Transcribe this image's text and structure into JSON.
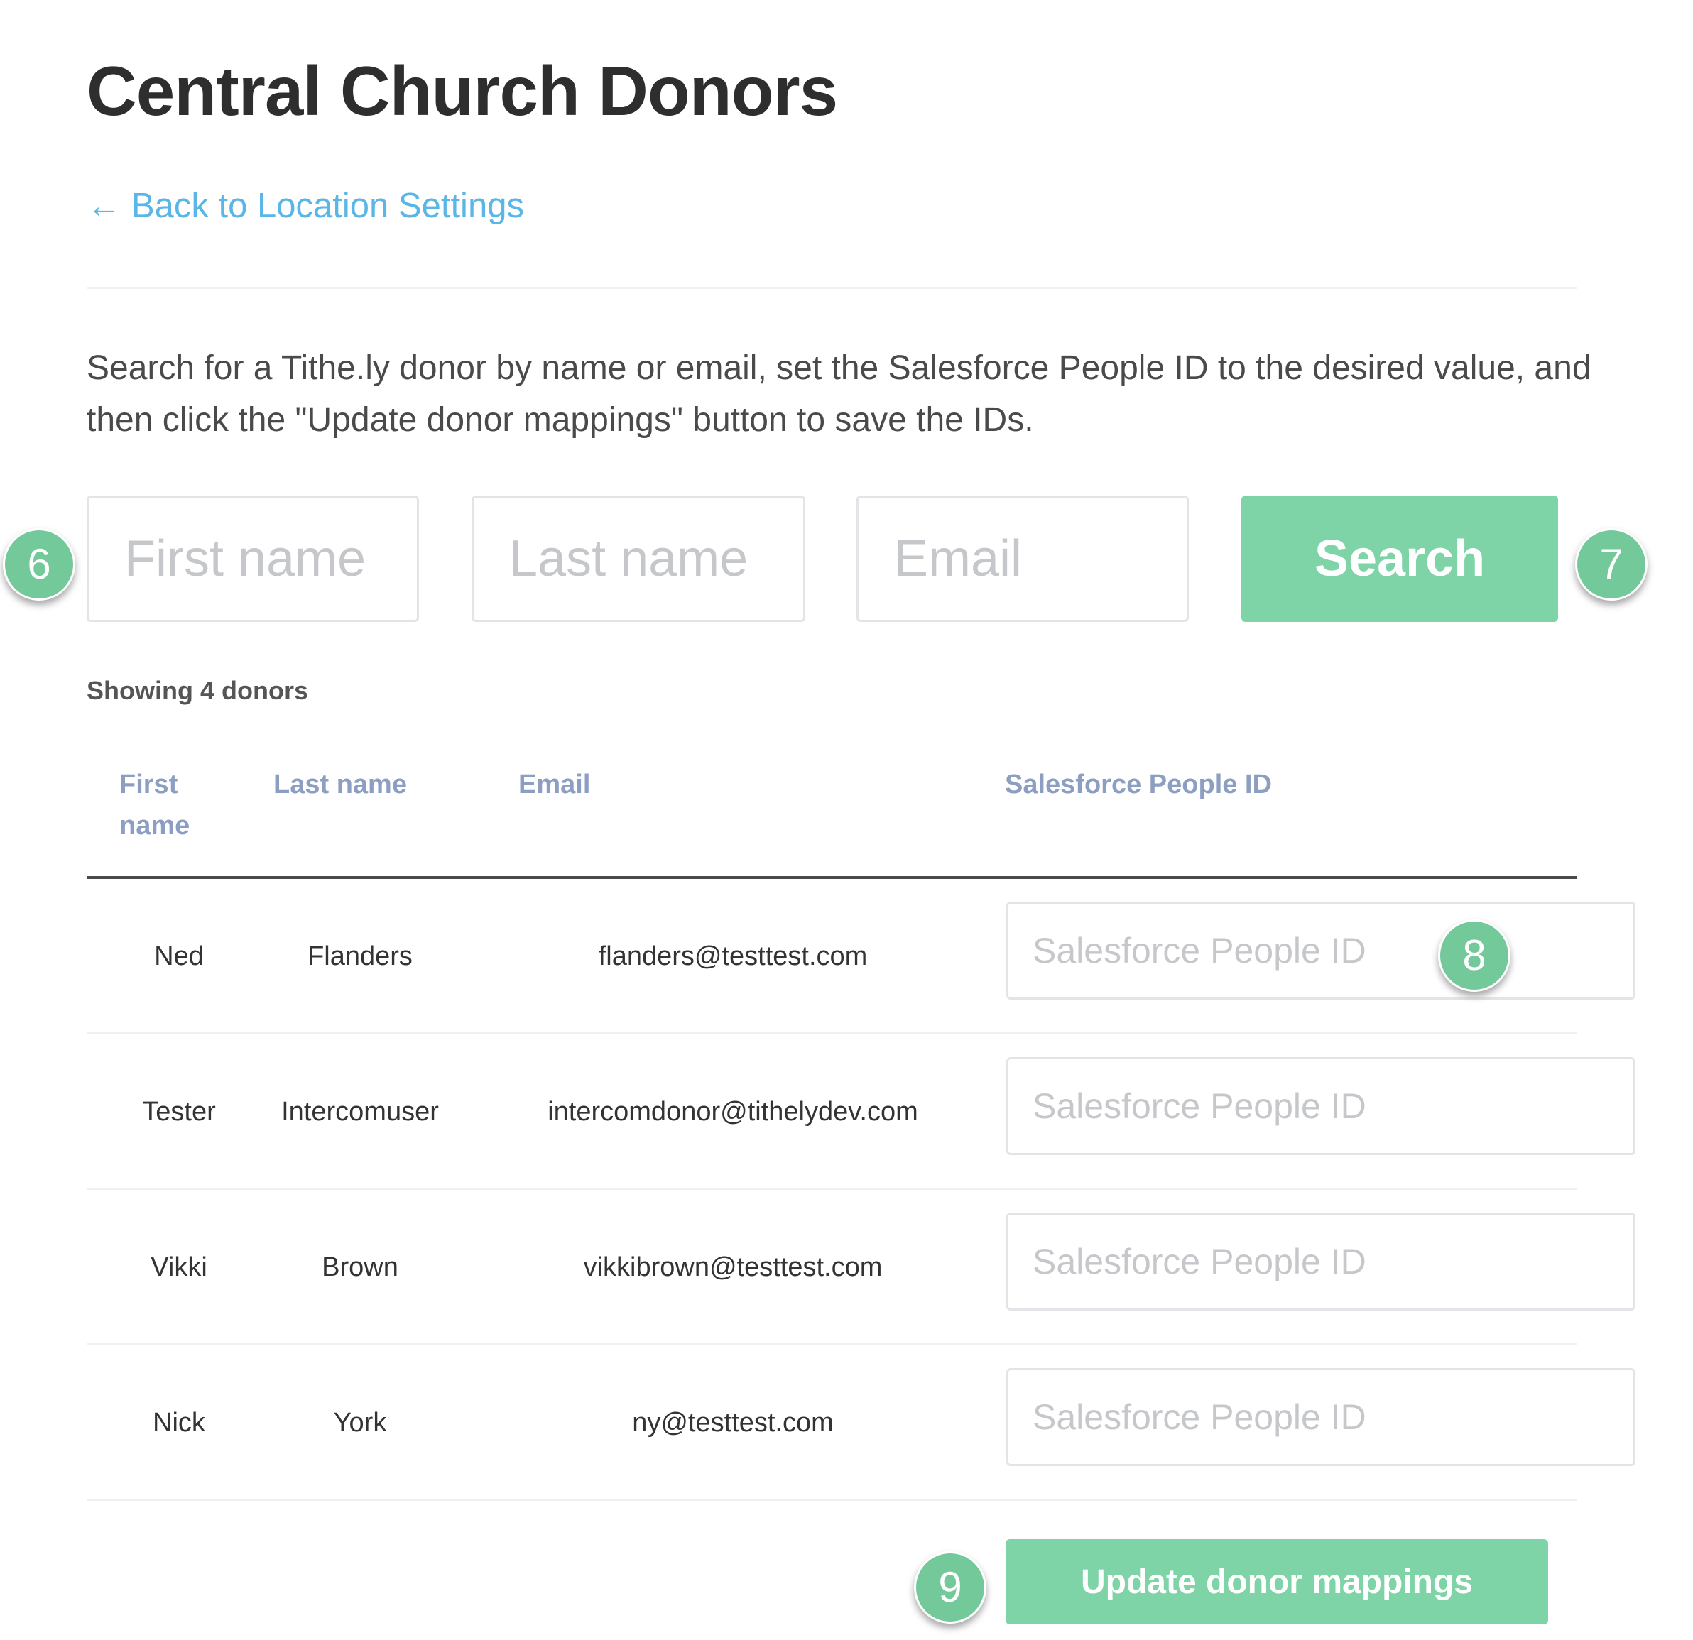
{
  "page": {
    "title": "Central Church Donors",
    "back_link": {
      "arrow": "←",
      "label": "Back to Location Settings"
    },
    "instructions": "Search for a Tithe.ly donor by name or email, set the Salesforce People ID to the desired value, and then click the \"Update donor mappings\" button to save the IDs."
  },
  "search": {
    "first_name_placeholder": "First name",
    "last_name_placeholder": "Last name",
    "email_placeholder": "Email",
    "button_label": "Search"
  },
  "results": {
    "count_text": "Showing 4 donors",
    "columns": {
      "first_name": "First name",
      "last_name": "Last name",
      "email": "Email",
      "salesforce_id": "Salesforce People ID"
    },
    "sfid_placeholder": "Salesforce People ID",
    "rows": [
      {
        "first": "Ned",
        "last": "Flanders",
        "email": "flanders@testtest.com",
        "sfid": ""
      },
      {
        "first": "Tester",
        "last": "Intercomuser",
        "email": "intercomdonor@tithelydev.com",
        "sfid": ""
      },
      {
        "first": "Vikki",
        "last": "Brown",
        "email": "vikkibrown@testtest.com",
        "sfid": ""
      },
      {
        "first": "Nick",
        "last": "York",
        "email": "ny@testtest.com",
        "sfid": ""
      }
    ]
  },
  "update_button_label": "Update donor mappings",
  "callouts": [
    "6",
    "7",
    "8",
    "9"
  ],
  "colors": {
    "accent_green": "#7ed4a6",
    "callout_green": "#74c99b",
    "link_blue": "#5ab6e6",
    "header_blue": "#8c9ec2"
  }
}
